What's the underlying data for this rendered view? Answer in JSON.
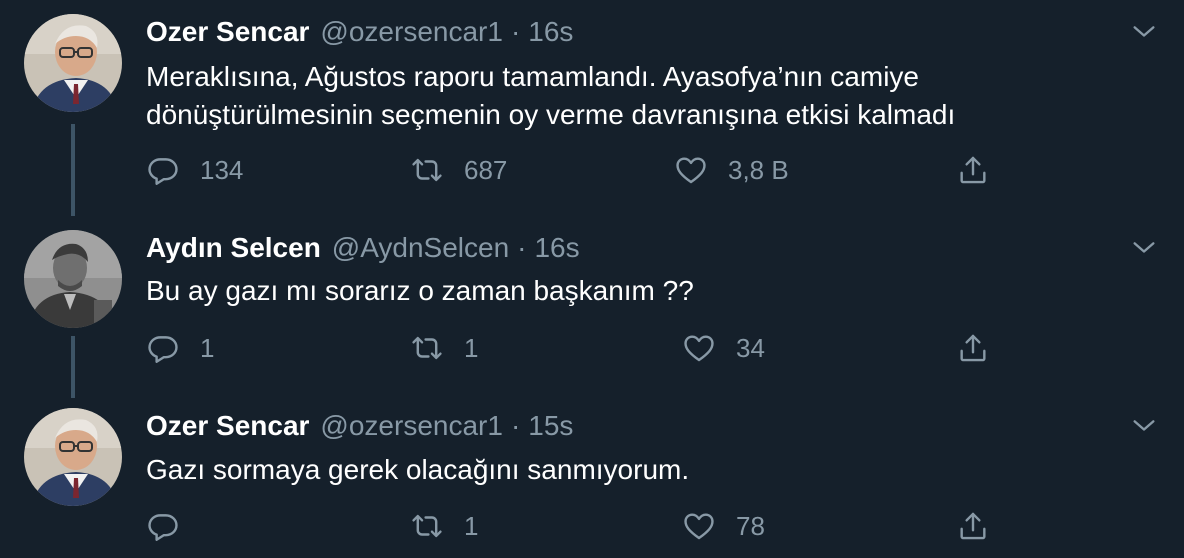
{
  "tweets": [
    {
      "name": "Ozer Sencar",
      "handle": "@ozersencar1",
      "separator": "·",
      "time": "16s",
      "text_lines": [
        "Meraklısına, Ağustos raporu tamamlandı. Ayasofya’nın camiye",
        "dönüştürülmesinin seçmenin oy verme davranışına etkisi kalmadı"
      ],
      "replies": "134",
      "retweets": "687",
      "likes": "3,8 B"
    },
    {
      "name": "Aydın Selcen",
      "handle": "@AydnSelcen",
      "separator": "·",
      "time": "16s",
      "text_lines": [
        "Bu ay gazı mı sorarız o zaman başkanım  ??"
      ],
      "replies": "1",
      "retweets": "1",
      "likes": "34"
    },
    {
      "name": "Ozer Sencar",
      "handle": "@ozersencar1",
      "separator": "·",
      "time": "15s",
      "text_lines": [
        "Gazı sormaya gerek olacağını sanmıyorum."
      ],
      "replies": "",
      "retweets": "1",
      "likes": "78"
    }
  ],
  "icons": {
    "reply": "reply-icon",
    "retweet": "retweet-icon",
    "like": "heart-icon",
    "share": "share-icon",
    "more": "chevron-down-icon"
  },
  "colors": {
    "background": "#15202b",
    "secondary_text": "#8899a6",
    "thread_line": "#3d5466"
  }
}
